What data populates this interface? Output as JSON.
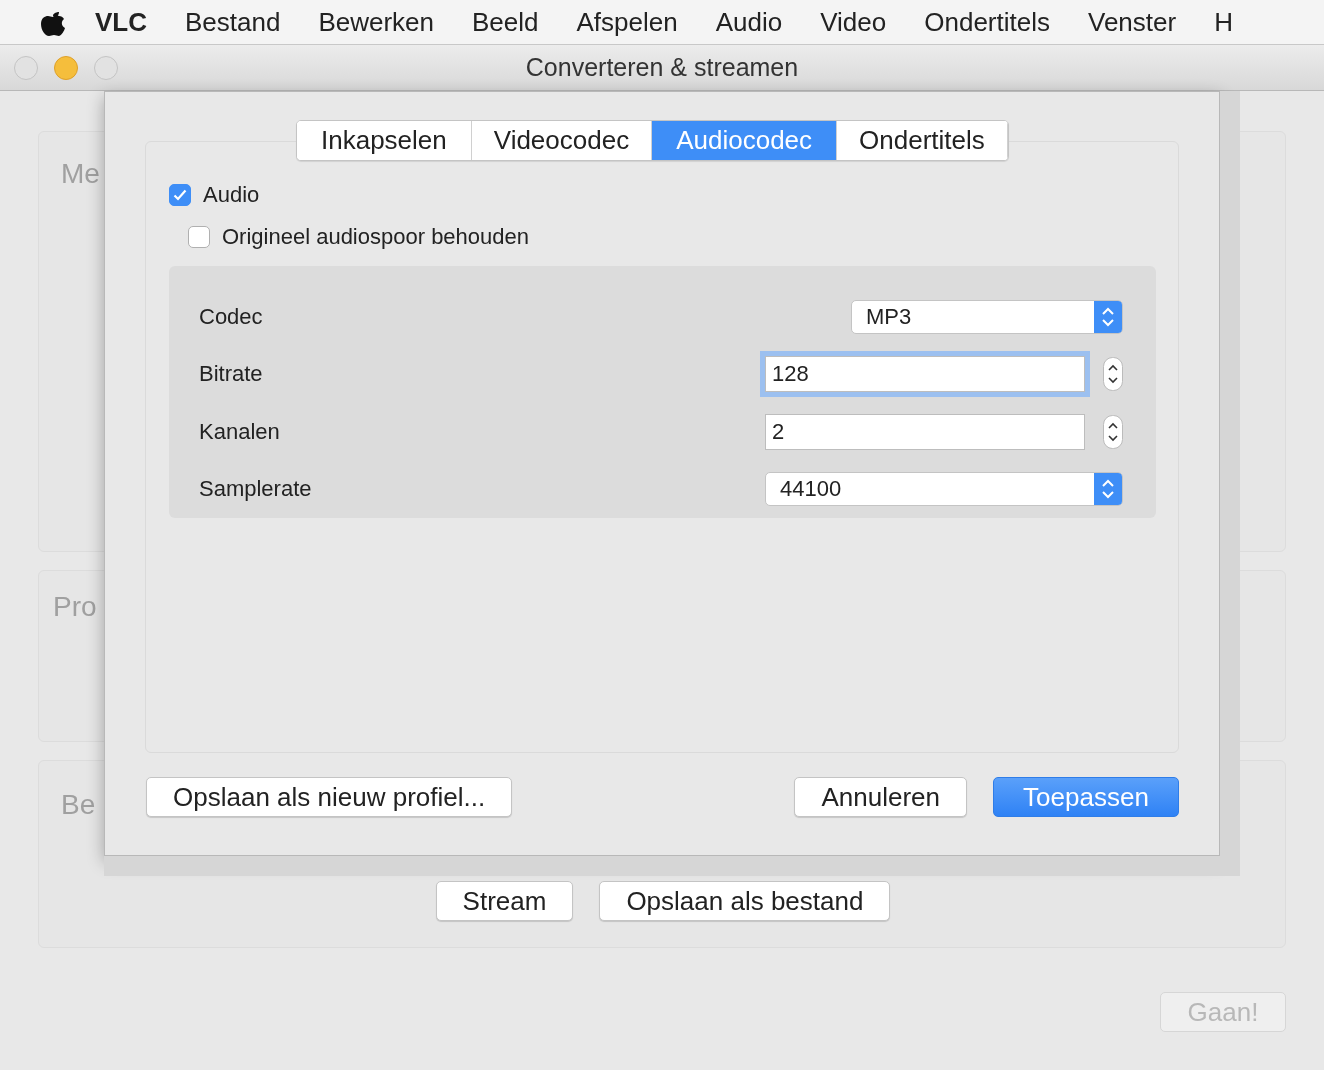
{
  "menu_bar": {
    "items": [
      {
        "label": "VLC",
        "kind": "app"
      },
      {
        "label": "Bestand",
        "kind": "menu"
      },
      {
        "label": "Bewerken",
        "kind": "menu"
      },
      {
        "label": "Beeld",
        "kind": "menu"
      },
      {
        "label": "Afspelen",
        "kind": "menu"
      },
      {
        "label": "Audio",
        "kind": "menu"
      },
      {
        "label": "Video",
        "kind": "menu"
      },
      {
        "label": "Ondertitels",
        "kind": "menu"
      },
      {
        "label": "Venster",
        "kind": "menu"
      },
      {
        "label": "H",
        "kind": "menu"
      }
    ]
  },
  "window": {
    "title": "Converteren & streamen"
  },
  "background": {
    "panels": [
      {
        "title": "Me"
      },
      {
        "title": "Pro"
      },
      {
        "title": "Be"
      }
    ],
    "buttons": [
      "Stream",
      "Opslaan als bestand"
    ],
    "go_button": {
      "label": "Gaan!",
      "disabled": true
    }
  },
  "dialog": {
    "tabs": [
      {
        "label": "Inkapselen",
        "selected": false
      },
      {
        "label": "Videocodec",
        "selected": false
      },
      {
        "label": "Audiocodec",
        "selected": true
      },
      {
        "label": "Ondertitels",
        "selected": false
      }
    ],
    "audio": {
      "label": "Audio",
      "checked": true
    },
    "keep_original": {
      "label": "Origineel audiospoor behouden",
      "checked": false
    },
    "fields": [
      {
        "label": "Codec",
        "kind": "select",
        "value": "MP3",
        "focused": false
      },
      {
        "label": "Bitrate",
        "kind": "spin",
        "value": "128",
        "focused": true
      },
      {
        "label": "Kanalen",
        "kind": "spin",
        "value": "2",
        "focused": false
      },
      {
        "label": "Samplerate",
        "kind": "select",
        "value": "44100",
        "focused": false
      }
    ],
    "save_profile": "Opslaan als nieuw profiel...",
    "cancel": "Annuleren",
    "apply": "Toepassen"
  }
}
